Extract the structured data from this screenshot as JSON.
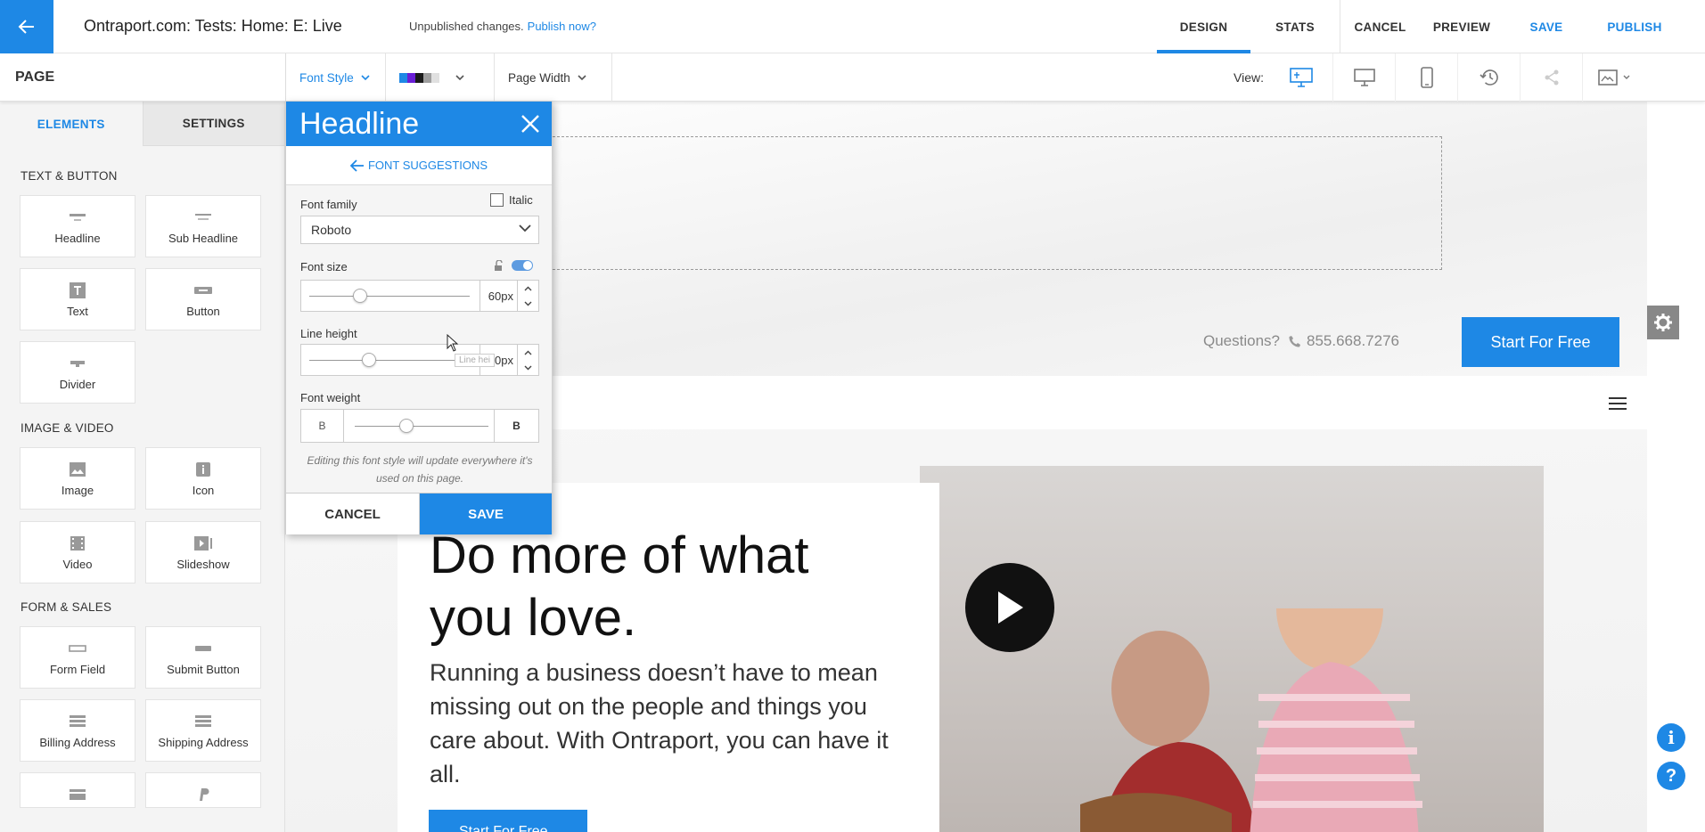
{
  "header": {
    "page_title": "Ontraport.com: Tests: Home: E: Live",
    "unpublished_text": "Unpublished changes.",
    "publish_link": "Publish now?",
    "actions": {
      "design": "DESIGN",
      "stats": "STATS",
      "cancel": "CANCEL",
      "preview": "PREVIEW",
      "save": "SAVE",
      "publish": "PUBLISH"
    }
  },
  "toolbar": {
    "page_label": "PAGE",
    "font_style": "Font Style",
    "page_width": "Page Width",
    "view_label": "View:",
    "swatch_colors": [
      "#1e88e5",
      "#6a1fd6",
      "#1a1a1a",
      "#9e9e9e",
      "#e0e0e0"
    ]
  },
  "sidebar": {
    "tabs": {
      "elements": "ELEMENTS",
      "settings": "SETTINGS"
    },
    "sections": [
      {
        "title": "TEXT & BUTTON",
        "items": [
          "Headline",
          "Sub Headline",
          "Text",
          "Button",
          "Divider"
        ]
      },
      {
        "title": "IMAGE & VIDEO",
        "items": [
          "Image",
          "Icon",
          "Video",
          "Slideshow"
        ]
      },
      {
        "title": "FORM & SALES",
        "items": [
          "Form Field",
          "Submit Button",
          "Billing Address",
          "Shipping Address"
        ]
      }
    ]
  },
  "panel": {
    "title": "Headline",
    "suggestions": "FONT SUGGESTIONS",
    "font_family_label": "Font family",
    "italic_label": "Italic",
    "font_family_value": "Roboto",
    "font_size_label": "Font size",
    "font_size_value": "60px",
    "line_height_label": "Line height",
    "line_height_value": "70px",
    "tooltip": "Line hei",
    "font_weight_label": "Font weight",
    "weight_min": "B",
    "weight_max": "B",
    "note": "Editing this font style will update everywhere it's used on this page.",
    "cancel": "CANCEL",
    "save": "SAVE"
  },
  "canvas": {
    "questions": "Questions?",
    "phone": "855.668.7276",
    "start_button": "Start For Free",
    "headline": "Do more of what you love.",
    "body": "Running a business doesn’t have to mean missing out on the people and things you care about. With Ontraport, you can have it all.",
    "cta": "Start For Free"
  },
  "colors": {
    "accent": "#1e88e5"
  }
}
